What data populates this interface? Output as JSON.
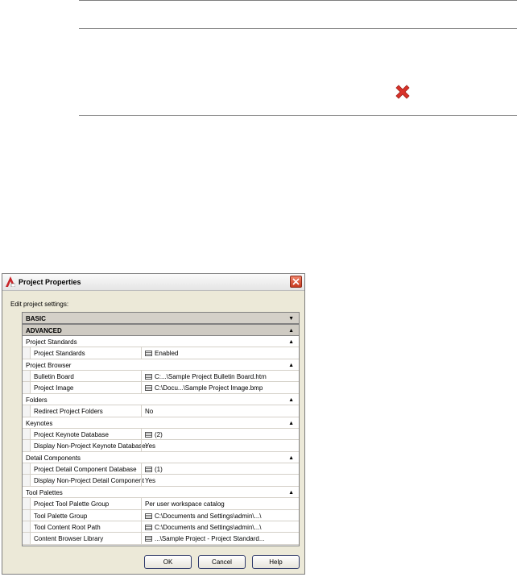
{
  "dialog": {
    "title": "Project Properties",
    "edit_label": "Edit project settings:",
    "buttons": {
      "ok": "OK",
      "cancel": "Cancel",
      "help": "Help"
    }
  },
  "grid": {
    "basic": "BASIC",
    "advanced": "ADVANCED",
    "rows": [
      {
        "kind": "sub",
        "label": "Project Standards"
      },
      {
        "kind": "prop",
        "name": "Project Standards",
        "value": "Enabled",
        "icon": true
      },
      {
        "kind": "sub",
        "label": "Project Browser"
      },
      {
        "kind": "prop",
        "name": "Bulletin Board",
        "value": "C:...\\Sample Project Bulletin Board.htm",
        "icon": true
      },
      {
        "kind": "prop",
        "name": "Project Image",
        "value": "C:\\Docu...\\Sample Project Image.bmp",
        "icon": true
      },
      {
        "kind": "sub",
        "label": "Folders"
      },
      {
        "kind": "prop",
        "name": "Redirect Project Folders",
        "value": "No",
        "icon": false
      },
      {
        "kind": "sub",
        "label": "Keynotes"
      },
      {
        "kind": "prop",
        "name": "Project Keynote Database",
        "value": "(2)",
        "icon": true
      },
      {
        "kind": "prop",
        "name": "Display Non-Project Keynote Databases",
        "value": "Yes",
        "icon": false
      },
      {
        "kind": "sub",
        "label": "Detail Components"
      },
      {
        "kind": "prop",
        "name": "Project Detail Component Database",
        "value": "(1)",
        "icon": true
      },
      {
        "kind": "prop",
        "name": "Display Non-Project Detail Component ...",
        "value": "Yes",
        "icon": false
      },
      {
        "kind": "sub",
        "label": "Tool Palettes"
      },
      {
        "kind": "prop",
        "name": "Project Tool Palette Group",
        "value": "Per user workspace catalog",
        "icon": false
      },
      {
        "kind": "prop",
        "name": "Tool Palette Group",
        "value": "C:\\Documents and Settings\\admin\\...\\",
        "icon": true
      },
      {
        "kind": "prop",
        "name": "Tool Content Root Path",
        "value": "C:\\Documents and Settings\\admin\\...\\",
        "icon": true
      },
      {
        "kind": "prop",
        "name": "Content Browser Library",
        "value": "...\\Sample Project - Project Standard...",
        "icon": true
      }
    ]
  },
  "colors": {
    "close_x": "#d9322a",
    "grid_bg": "#f4f4f4",
    "category_bg": "#d4d0c8"
  },
  "icons": {
    "top_close": "x-icon",
    "dialog_close": "close-icon"
  }
}
